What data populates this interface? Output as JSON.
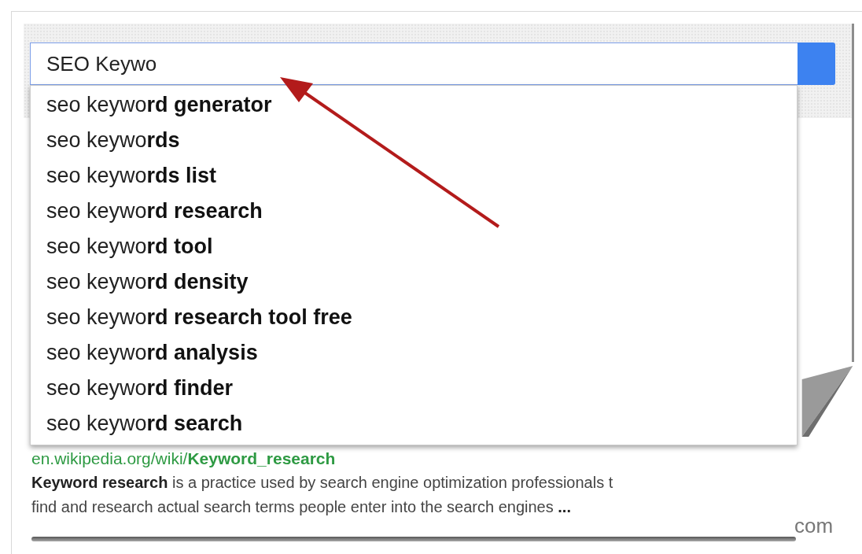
{
  "search": {
    "value": "SEO Keywo"
  },
  "suggestions": [
    "seo keywo**rd generator**",
    "seo keywo**rds**",
    "seo keywo**rds list**",
    "seo keywo**rd research**",
    "seo keywo**rd tool**",
    "seo keywo**rd density**",
    "seo keywo**rd research tool free**",
    "seo keywo**rd analysis**",
    "seo keywo**rd finder**",
    "seo keywo**rd search**"
  ],
  "result": {
    "url": "en.wikipedia.org/wiki/**Keyword_research**",
    "snippet_lines": [
      "**Keyword research** is a practice used by search engine optimization professionals t",
      "find and research actual search terms people enter into the search engines **...**"
    ]
  },
  "corner_text": "com"
}
